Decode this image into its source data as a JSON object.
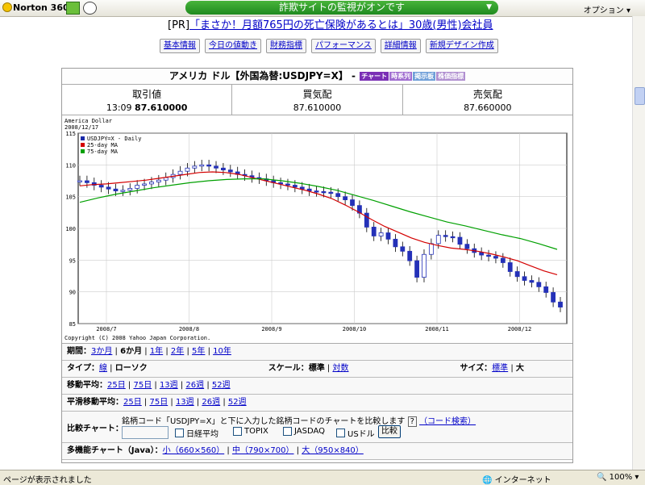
{
  "toolbar": {
    "app_name": "Norton 360",
    "phishing_status": "詐欺サイトの監視がオンです",
    "options_label": "オプション"
  },
  "ad": {
    "prefix": "[PR]",
    "link_text": "「まさか！月額765円の死亡保険があるとは」30歳(男性)会社員"
  },
  "tabs": [
    "基本情報",
    "今日の値動き",
    "財務指標",
    "パフォーマンス",
    "詳細情報",
    "新規デザイン作成"
  ],
  "title": {
    "text": "アメリカ ドル【外国為替:USDJPY=X】 -",
    "badges": [
      {
        "label": "チャート",
        "color": "#7a2fb5"
      },
      {
        "label": "時系列",
        "color": "#a06dd0"
      },
      {
        "label": "掲示板",
        "color": "#6f9fd8"
      },
      {
        "label": "株価指標",
        "color": "#b08fd0"
      }
    ]
  },
  "quote": {
    "trade_label": "取引値",
    "trade_time": "13:09",
    "trade_value": "87.610000",
    "bid_label": "買気配",
    "bid_value": "87.610000",
    "ask_label": "売気配",
    "ask_value": "87.660000"
  },
  "chart_data": {
    "type": "line",
    "title": "America Dollar",
    "date": "2008/12/17",
    "copyright": "Copyright (C) 2008 Yahoo Japan Corporation.",
    "x_ticks": [
      "2008/7",
      "2008/8",
      "2008/9",
      "2008/10",
      "2008/11",
      "2008/12"
    ],
    "ylim": [
      85,
      115
    ],
    "y_ticks": [
      85,
      90,
      95,
      100,
      105,
      110,
      115
    ],
    "legend": [
      "USDJPY=X - Daily",
      "25-day MA",
      "75-day MA"
    ],
    "series": [
      {
        "name": "USDJPY=X - Daily",
        "color": "#1a2aa8",
        "values": [
          107.5,
          107.2,
          106.8,
          106.5,
          106.2,
          105.9,
          106.0,
          106.3,
          106.8,
          107.0,
          107.3,
          107.6,
          108.0,
          108.5,
          109.0,
          109.5,
          109.8,
          110.0,
          109.8,
          109.5,
          109.2,
          108.9,
          108.5,
          108.3,
          108.0,
          107.8,
          107.5,
          107.2,
          107.0,
          106.8,
          106.5,
          106.2,
          105.9,
          105.8,
          105.7,
          105.5,
          105.0,
          104.5,
          103.6,
          102.4,
          100.2,
          98.8,
          99.3,
          98.3,
          97.1,
          96.4,
          94.9,
          92.3,
          95.9,
          97.6,
          98.9,
          98.7,
          98.6,
          97.5,
          96.8,
          96.2,
          95.8,
          95.6,
          95.3,
          94.6,
          93.2,
          92.4,
          91.8,
          91.5,
          90.8,
          89.9,
          88.4,
          87.6
        ]
      },
      {
        "name": "25-day MA",
        "color": "#d40000",
        "values": [
          106.7,
          106.9,
          107.0,
          107.2,
          107.4,
          107.6,
          107.9,
          108.2,
          108.5,
          108.8,
          108.9,
          108.8,
          108.5,
          108.0,
          107.5,
          107.0,
          106.5,
          106.0,
          105.4,
          104.7,
          103.7,
          102.6,
          101.4,
          100.3,
          99.4,
          98.5,
          97.8,
          97.3,
          96.9,
          96.7,
          96.4,
          96.0,
          95.5,
          94.9,
          94.1,
          93.3,
          92.7
        ]
      },
      {
        "name": "75-day MA",
        "color": "#00a000",
        "values": [
          104.1,
          104.8,
          105.4,
          105.9,
          106.4,
          106.8,
          107.2,
          107.5,
          107.7,
          107.8,
          107.8,
          107.5,
          107.1,
          106.6,
          106.0,
          105.2,
          104.4,
          103.5,
          102.6,
          101.8,
          101.0,
          100.4,
          99.7,
          99.0,
          98.4,
          97.6,
          96.7
        ]
      }
    ]
  },
  "period_row": {
    "label": "期間：",
    "options": [
      "3か月",
      "6か月",
      "1年",
      "2年",
      "5年",
      "10年"
    ],
    "selected": "6か月"
  },
  "type_row": {
    "label": "タイプ：",
    "options": [
      "線",
      "ローソク"
    ],
    "selected": "ローソク",
    "scale_label": "スケール：",
    "scale_options": [
      "標準",
      "対数"
    ],
    "scale_selected": "標準",
    "size_label": "サイズ：",
    "size_options": [
      "標準",
      "大"
    ],
    "size_selected": "大"
  },
  "ma_row": {
    "label": "移動平均：",
    "options": [
      "25日",
      "75日",
      "13週",
      "26週",
      "52週"
    ]
  },
  "smooth_row": {
    "label": "平滑移動平均：",
    "options": [
      "25日",
      "75日",
      "13週",
      "26週",
      "52週"
    ]
  },
  "compare": {
    "label": "比較チャート：",
    "description": "銘柄コード「USDJPY=X」と下に入力した銘柄コードのチャートを比較します",
    "help": "?",
    "code_search": "（コード検索）",
    "checkboxes": [
      "日経平均",
      "TOPIX",
      "JASDAQ",
      "USドル"
    ],
    "button": "比較"
  },
  "multi_row": {
    "label": "多機能チャート（Java）：",
    "links": [
      "小（660×560）",
      "中（790×700）",
      "大（950×840）"
    ]
  },
  "status": {
    "text": "ページが表示されました",
    "zone": "インターネット",
    "zoom": "100%"
  }
}
